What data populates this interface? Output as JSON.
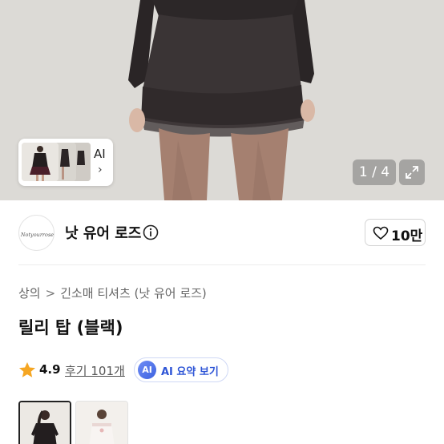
{
  "hero": {
    "counter": "1 / 4",
    "ai_label": "AI",
    "ai_chevron": "›"
  },
  "brand": {
    "name": "낫 유어 로즈",
    "logo_text": "Notyourrose",
    "like_count": "10만"
  },
  "breadcrumb": {
    "level1": "상의",
    "separator": ">",
    "level2": "긴소매 티셔츠 (낫 유어 로즈)"
  },
  "product": {
    "title": "릴리 탑 (블랙)",
    "rating": "4.9",
    "reviews": "후기 101개"
  },
  "ai_summary": {
    "badge": "AI",
    "label": "AI 요약 보기"
  },
  "icons": {
    "info": "info-icon",
    "heart": "heart-icon",
    "star": "star-icon",
    "expand": "expand-icon",
    "chevron": "chevron-right-icon"
  },
  "colors": {
    "star": "#f5a623",
    "ai_accent": "#2e55d6",
    "counter_bg": "#787878"
  }
}
